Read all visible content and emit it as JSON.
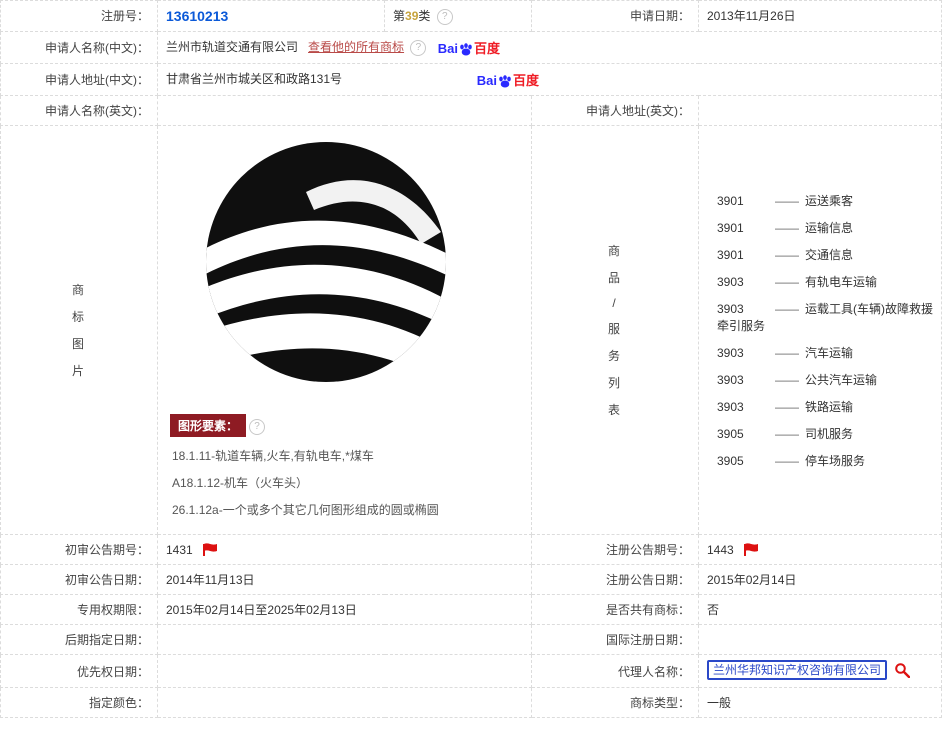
{
  "labels": {
    "reg_no": "注册号：",
    "category_prefix": "第",
    "category_suffix": "类",
    "apply_date": "申请日期：",
    "applicant_cn": "申请人名称(中文)：",
    "applicant_addr_cn": "申请人地址(中文)：",
    "applicant_en": "申请人名称(英文)：",
    "applicant_addr_en": "申请人地址(英文)：",
    "vlabel_left_1": "商",
    "vlabel_left_2": "标",
    "vlabel_left_3": "图",
    "vlabel_left_4": "片",
    "vlabel_right_1": "商",
    "vlabel_right_2": "品",
    "vlabel_right_3": "/",
    "vlabel_right_4": "服",
    "vlabel_right_5": "务",
    "vlabel_right_6": "列",
    "vlabel_right_7": "表",
    "gfx_elements": "图形要素：",
    "prelim_pub_no": "初审公告期号：",
    "reg_pub_no": "注册公告期号：",
    "prelim_pub_date": "初审公告日期：",
    "reg_pub_date": "注册公告日期：",
    "right_period": "专用权期限：",
    "is_shared": "是否共有商标：",
    "post_designation_date": "后期指定日期：",
    "intl_reg_date": "国际注册日期：",
    "priority_date": "优先权日期：",
    "agent_name": "代理人名称：",
    "designated_color": "指定颜色：",
    "tm_type": "商标类型：",
    "view_all_tm": "查看他的所有商标"
  },
  "values": {
    "reg_no": "13610213",
    "category_num": "39",
    "apply_date": "2013年11月26日",
    "applicant_cn": "兰州市轨道交通有限公司",
    "applicant_addr_cn": "甘肃省兰州市城关区和政路131号",
    "applicant_en": "",
    "applicant_addr_en": "",
    "prelim_pub_no": "1431",
    "reg_pub_no": "1443",
    "prelim_pub_date": "2014年11月13日",
    "reg_pub_date": "2015年02月14日",
    "right_period": "2015年02月14日至2025年02月13日",
    "is_shared": "否",
    "post_designation_date": "",
    "intl_reg_date": "",
    "priority_date": "",
    "agent_name": "兰州华邦知识产权咨询有限公司",
    "designated_color": "",
    "tm_type": "一般"
  },
  "gfx": {
    "items": [
      "18.1.11-轨道车辆,火车,有轨电车,*煤车",
      "A18.1.12-机车（火车头）",
      "26.1.12a-一个或多个其它几何图形组成的圆或椭圆"
    ]
  },
  "services": {
    "items": [
      {
        "code": "3901",
        "name": "运送乘客"
      },
      {
        "code": "3901",
        "name": "运输信息"
      },
      {
        "code": "3901",
        "name": "交通信息"
      },
      {
        "code": "3903",
        "name": "有轨电车运输"
      },
      {
        "code": "3903",
        "name": "运载工具(车辆)故障救援牵引服务"
      },
      {
        "code": "3903",
        "name": "汽车运输"
      },
      {
        "code": "3903",
        "name": "公共汽车运输"
      },
      {
        "code": "3903",
        "name": "铁路运输"
      },
      {
        "code": "3905",
        "name": "司机服务"
      },
      {
        "code": "3905",
        "name": "停车场服务"
      }
    ]
  },
  "baidu": {
    "bai": "Bai",
    "du": "百度"
  }
}
